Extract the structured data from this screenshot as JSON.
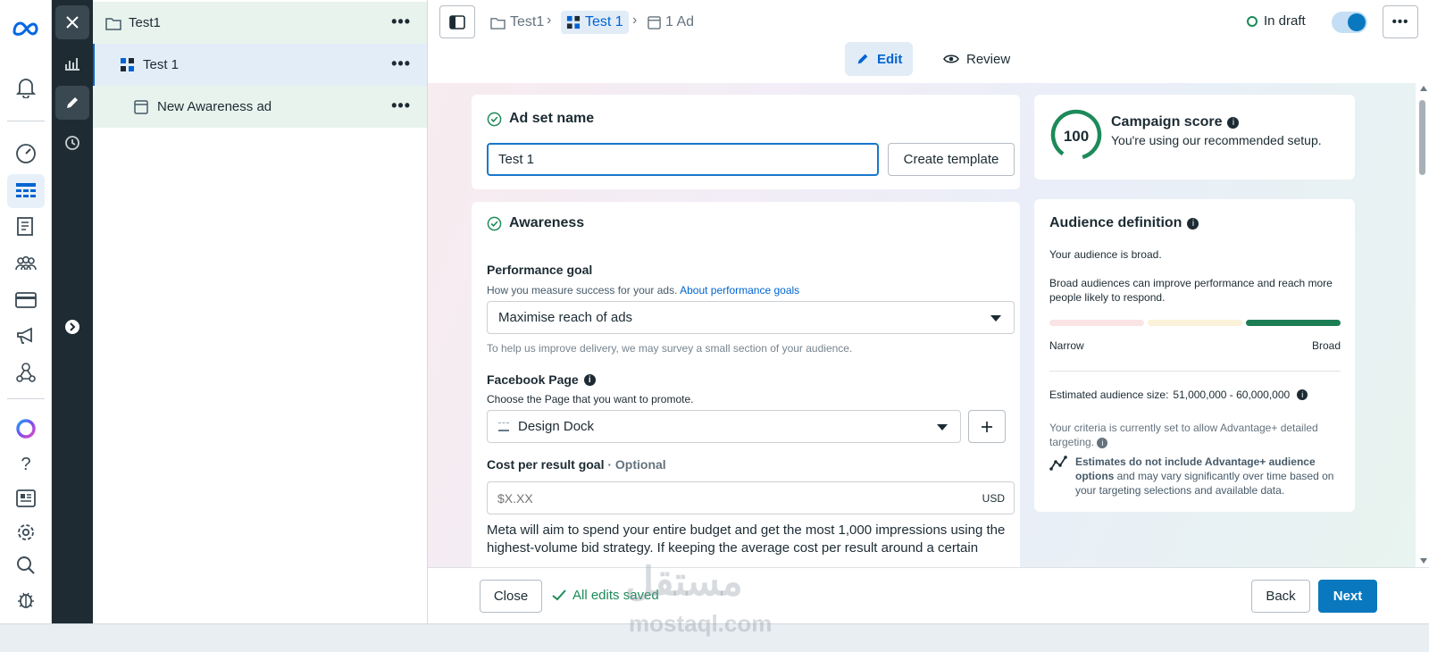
{
  "tree": {
    "campaign": "Test1",
    "adset": "Test 1",
    "ad": "New Awareness ad"
  },
  "breadcrumbs": {
    "campaign": "Test1",
    "adset": "Test 1",
    "ads": "1 Ad"
  },
  "status": {
    "label": "In draft"
  },
  "modes": {
    "edit": "Edit",
    "review": "Review"
  },
  "adset_name": {
    "heading": "Ad set name",
    "value": "Test 1",
    "create_template": "Create template"
  },
  "awareness": {
    "heading": "Awareness",
    "performance_goal": {
      "label": "Performance goal",
      "help": "How you measure success for your ads.",
      "help_link": "About performance goals",
      "selected": "Maximise reach of ads",
      "note": "To help us improve delivery, we may survey a small section of your audience."
    },
    "facebook_page": {
      "label": "Facebook Page",
      "help": "Choose the Page that you want to promote.",
      "selected": "Design Dock"
    },
    "cost_goal": {
      "label": "Cost per result goal",
      "optional": "· Optional",
      "placeholder": "$X.XX",
      "currency": "USD",
      "description": "Meta will aim to spend your entire budget and get the most 1,000 impressions using the highest-volume bid strategy. If keeping the average cost per result around a certain"
    }
  },
  "campaign_score": {
    "score": "100",
    "title": "Campaign score",
    "subtitle": "You're using our recommended setup."
  },
  "audience": {
    "title": "Audience definition",
    "status": "Your audience is broad.",
    "description": "Broad audiences can improve performance and reach more people likely to respond.",
    "narrow_label": "Narrow",
    "broad_label": "Broad",
    "size_label": "Estimated audience size:",
    "size_value": "51,000,000 - 60,000,000",
    "criteria_note": "Your criteria is currently set to allow Advantage+ detailed targeting.",
    "estimate_bold": "Estimates do not include Advantage+ audience options",
    "estimate_rest": " and may vary significantly over time based on your targeting selections and available data."
  },
  "bottom": {
    "close": "Close",
    "saved": "All edits saved",
    "back": "Back",
    "next": "Next"
  },
  "watermark": {
    "arabic": "مستقل",
    "latin": "mostaql.com"
  },
  "colors": {
    "accent": "#0064d1",
    "primary_button": "#0a78be",
    "success": "#1d8a5a",
    "dark_rail": "#1e2b32"
  }
}
